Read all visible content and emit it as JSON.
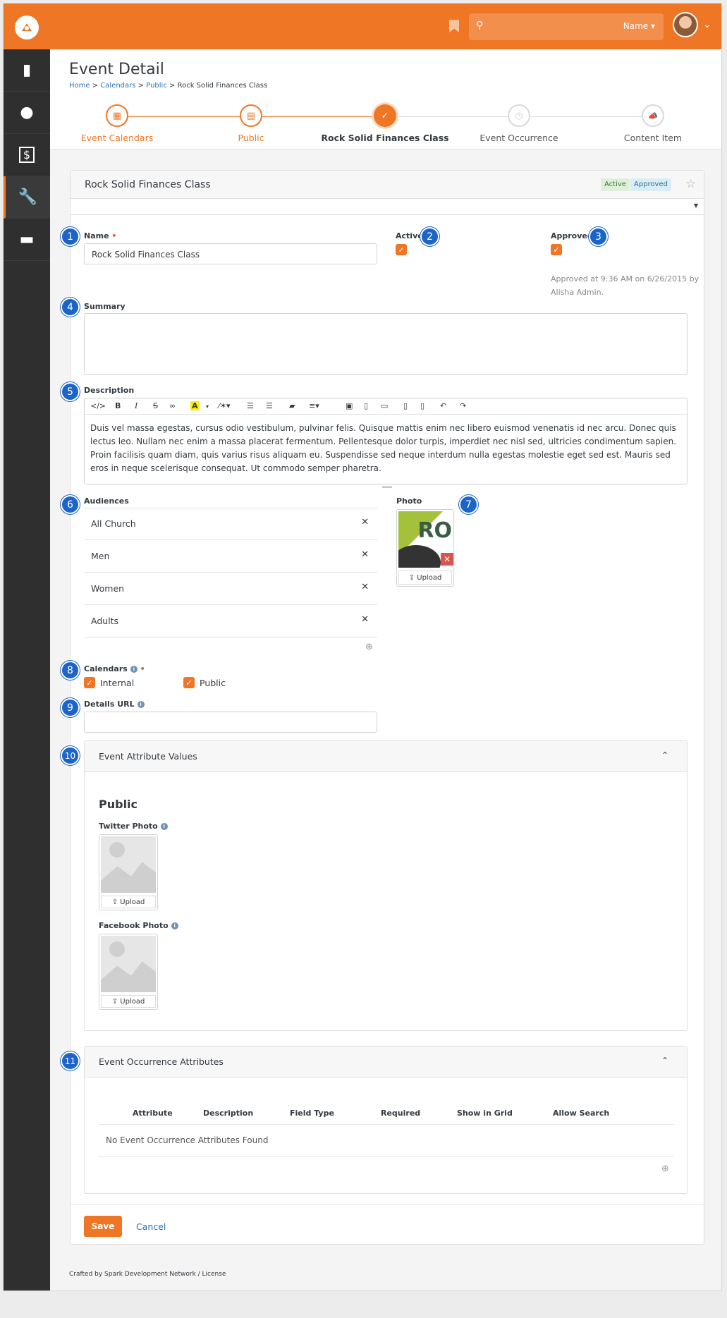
{
  "header": {
    "search_user_label": "Name ▾"
  },
  "sidebar": {
    "items": [
      "📕",
      "👤",
      "💵",
      "🔧",
      "💼"
    ]
  },
  "page": {
    "title": "Event Detail",
    "breadcrumb": [
      "Home",
      "Calendars",
      "Public",
      "Rock Solid Finances Class"
    ],
    "steps": [
      {
        "label": "Event Calendars",
        "icon": "▦"
      },
      {
        "label": "Public",
        "icon": "▤"
      },
      {
        "label": "Rock Solid Finances Class",
        "icon": "✓"
      },
      {
        "label": "Event Occurrence",
        "icon": "◷"
      },
      {
        "label": "Content Item",
        "icon": "📣"
      }
    ]
  },
  "card": {
    "title": "Rock Solid Finances Class",
    "badge_active": "Active",
    "badge_approved": "Approved"
  },
  "form": {
    "name_label": "Name",
    "name_value": "Rock Solid Finances Class",
    "active_label": "Active",
    "approved_label": "Approved",
    "approved_note_1": "Approved at 9:36 AM on 6/26/2015 by",
    "approved_note_2": "Alisha Admin.",
    "summary_label": "Summary",
    "description_label": "Description",
    "description_text": "Duis vel massa egestas, cursus odio vestibulum, pulvinar felis. Quisque mattis enim nec libero euismod venenatis id nec arcu. Donec quis lectus leo. Nullam nec enim a massa placerat fermentum. Pellentesque dolor turpis, imperdiet nec nisl sed, ultricies condimentum sapien. Proin facilisis quam diam, quis varius risus aliquam eu. Suspendisse sed neque interdum nulla egestas molestie eget sed est. Mauris sed eros in neque scelerisque consequat. Ut commodo semper pharetra.",
    "audiences_label": "Audiences",
    "audiences": [
      "All Church",
      "Men",
      "Women",
      "Adults"
    ],
    "photo_label": "Photo",
    "photo_text": "RO",
    "upload_label": "Upload",
    "calendars_label": "Calendars",
    "calendar_options": [
      "Internal",
      "Public"
    ],
    "details_url_label": "Details URL"
  },
  "attributes_panel": {
    "title": "Event Attribute Values",
    "section": "Public",
    "twitter_label": "Twitter Photo",
    "facebook_label": "Facebook Photo",
    "upload_label": "Upload"
  },
  "occurrence_panel": {
    "title": "Event Occurrence Attributes",
    "columns": [
      "Attribute",
      "Description",
      "Field Type",
      "Required",
      "Show in Grid",
      "Allow Search"
    ],
    "empty": "No Event Occurrence Attributes Found"
  },
  "actions": {
    "save": "Save",
    "cancel": "Cancel"
  },
  "footer": "Crafted by Spark Development Network / License",
  "markers": [
    "1",
    "2",
    "3",
    "4",
    "5",
    "6",
    "7",
    "8",
    "9",
    "10",
    "11"
  ],
  "colors": {
    "brand": "#ee7624",
    "marker": "#1c64c8",
    "link": "#2c71b5"
  }
}
